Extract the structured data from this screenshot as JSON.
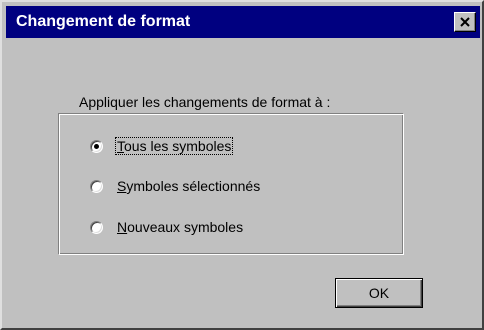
{
  "window": {
    "title": "Changement de format",
    "close_icon": "close-icon"
  },
  "dialog": {
    "instruction": "Appliquer les changements de format à :",
    "options": [
      {
        "first": "T",
        "rest": "ous les symboles",
        "selected": true
      },
      {
        "first": "S",
        "rest": "ymboles sélectionnés",
        "selected": false
      },
      {
        "first": "N",
        "rest": "ouveaux symboles",
        "selected": false
      }
    ],
    "ok_label": "OK"
  },
  "colors": {
    "titlebar": "#000080",
    "face": "#c0c0c0"
  }
}
